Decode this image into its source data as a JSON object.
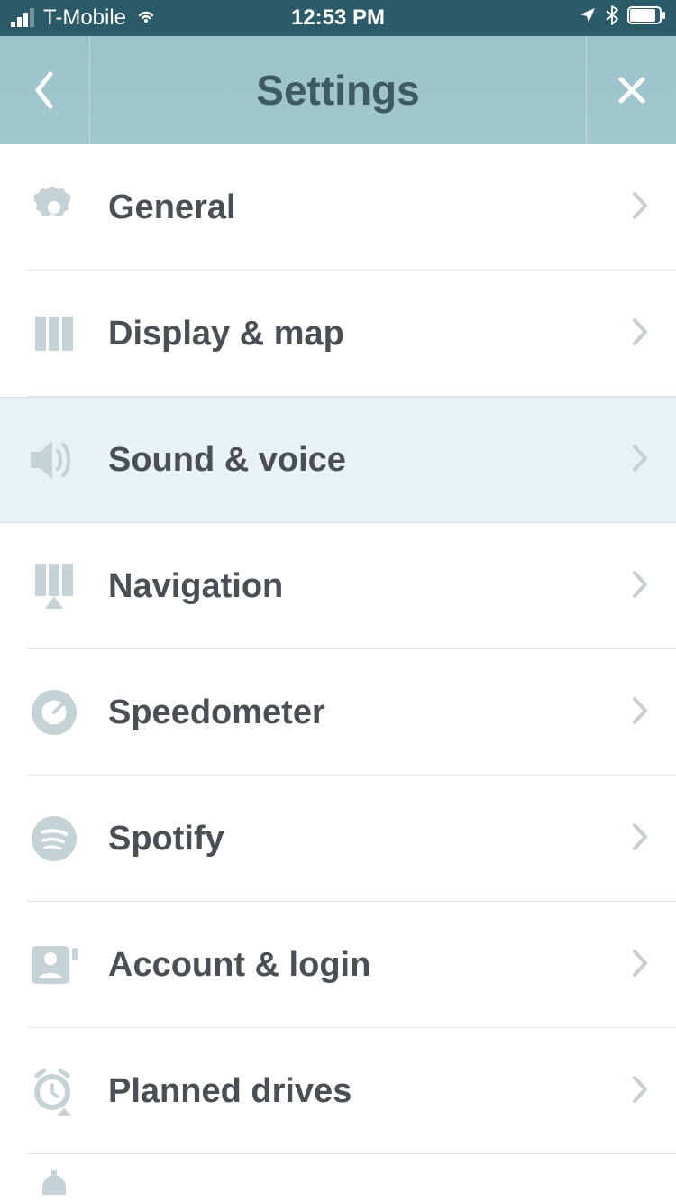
{
  "status_bar": {
    "carrier": "T-Mobile",
    "time": "12:53 PM"
  },
  "nav": {
    "title": "Settings"
  },
  "settings": {
    "items": [
      {
        "label": "General",
        "icon": "gear-icon",
        "highlight": false
      },
      {
        "label": "Display & map",
        "icon": "map-icon",
        "highlight": false
      },
      {
        "label": "Sound & voice",
        "icon": "speaker-icon",
        "highlight": true
      },
      {
        "label": "Navigation",
        "icon": "navigation-icon",
        "highlight": false
      },
      {
        "label": "Speedometer",
        "icon": "gauge-icon",
        "highlight": false
      },
      {
        "label": "Spotify",
        "icon": "spotify-icon",
        "highlight": false
      },
      {
        "label": "Account & login",
        "icon": "account-icon",
        "highlight": false
      },
      {
        "label": "Planned drives",
        "icon": "clock-icon",
        "highlight": false
      }
    ]
  }
}
